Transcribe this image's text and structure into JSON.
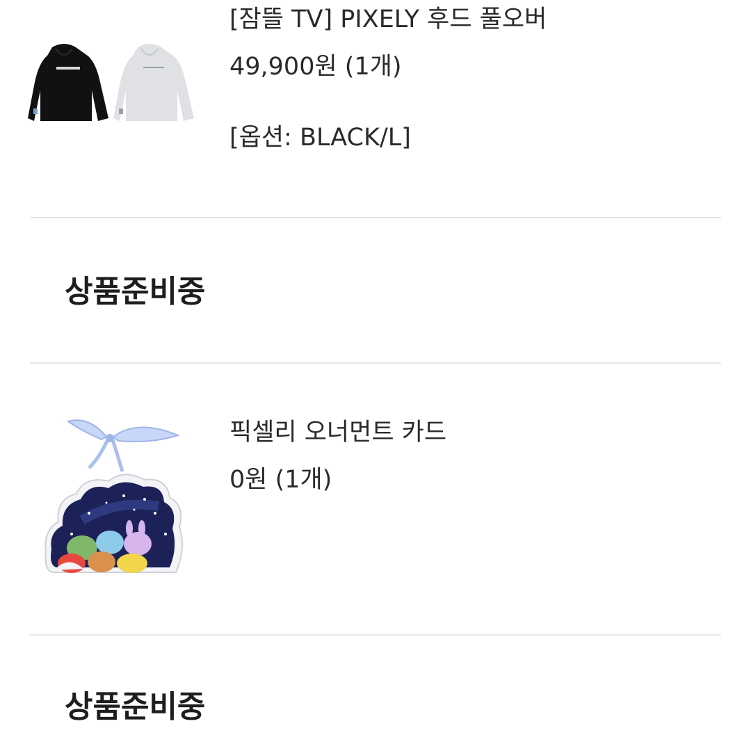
{
  "orders": [
    {
      "title": "[잠뜰 TV] PIXELY 후드 풀오버",
      "price": "49,900원 (1개)",
      "option": "[옵션: BLACK/L]",
      "status": "상품준비중",
      "image": "hoodie-pair-image"
    },
    {
      "title": "픽셀리 오너먼트 카드",
      "price": "0원 (1개)",
      "status": "상품준비중",
      "image": "ornament-card-image"
    }
  ],
  "colors": {
    "divider": "#e6e6e6",
    "text": "#2a2a2a",
    "hoodie_black": "#111111",
    "hoodie_gray": "#dfe1e4",
    "ornament_sky": "#1c2257",
    "ribbon": "#b7c9f2"
  }
}
